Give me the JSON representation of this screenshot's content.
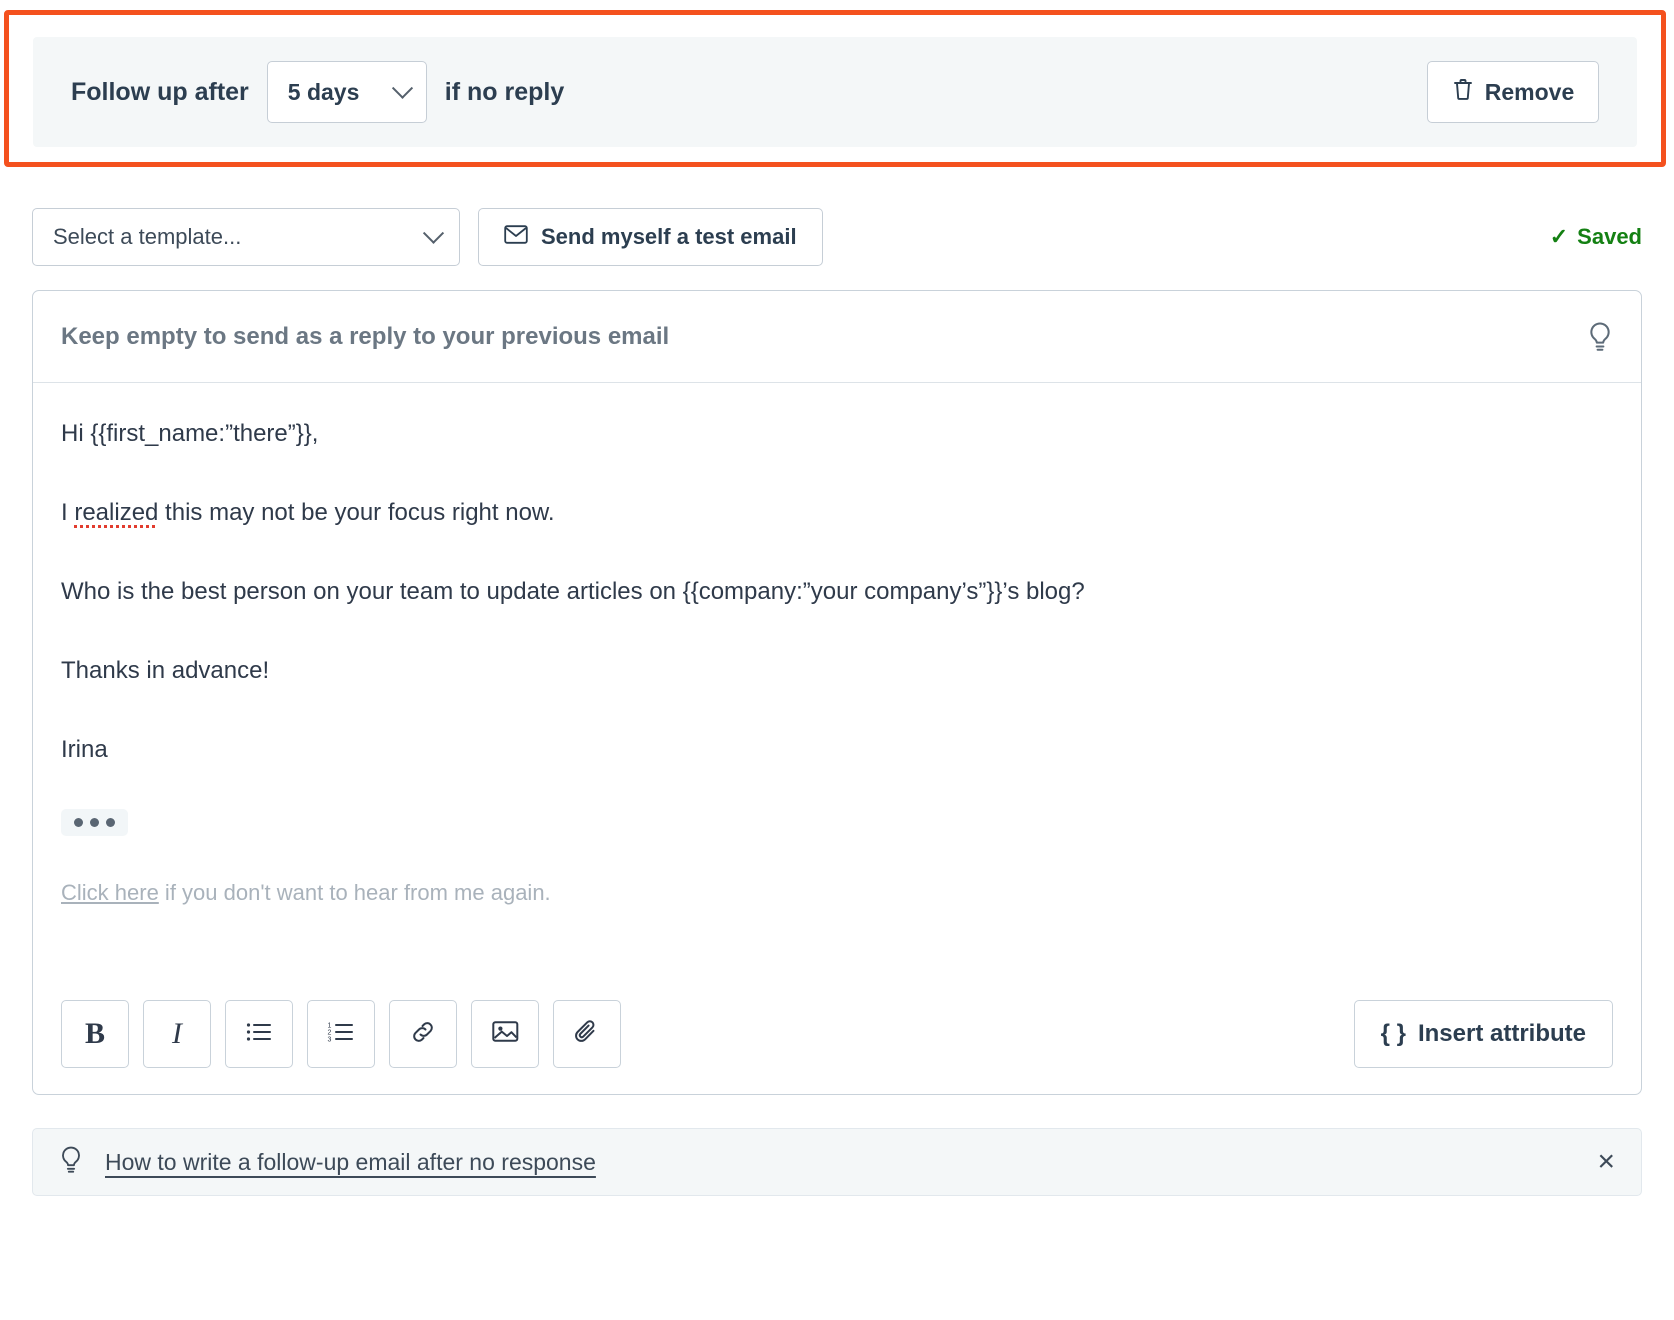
{
  "followup": {
    "prefix_label": "Follow up after",
    "delay_value": "5 days",
    "suffix_label": "if no reply",
    "remove_label": "Remove",
    "highlight_color": "#f4511e"
  },
  "template_row": {
    "template_select_value": "Select a template...",
    "test_email_label": "Send myself a test email",
    "saved_label": "Saved",
    "saved_color": "#148013",
    "check_glyph": "✓"
  },
  "email": {
    "subject_placeholder": "Keep empty to send as a reply to your previous email",
    "body": {
      "greeting": "Hi {{first_name:”there”}},",
      "line2_pre": "I ",
      "line2_misspelled": "realized",
      "line2_post": " this may not be your focus right now.",
      "line3": "Who is the best person on your team to update articles on {{company:”your company’s”}}’s blog?",
      "line4": "Thanks in advance!",
      "signature_name": "Irina"
    },
    "unsubscribe": {
      "link_text": "Click here",
      "rest_text": " if you don't want to hear from me again."
    }
  },
  "toolbar": {
    "buttons": [
      {
        "name": "bold",
        "label": "B"
      },
      {
        "name": "italic",
        "label": "I"
      },
      {
        "name": "bulleted-list",
        "label": ""
      },
      {
        "name": "numbered-list",
        "label": ""
      },
      {
        "name": "link",
        "label": ""
      },
      {
        "name": "image",
        "label": ""
      },
      {
        "name": "attachment",
        "label": ""
      }
    ],
    "insert_attribute_label": "Insert attribute",
    "insert_attribute_braces": "{ }"
  },
  "tip": {
    "text": "How to write a follow-up email after no response",
    "close_glyph": "×"
  }
}
